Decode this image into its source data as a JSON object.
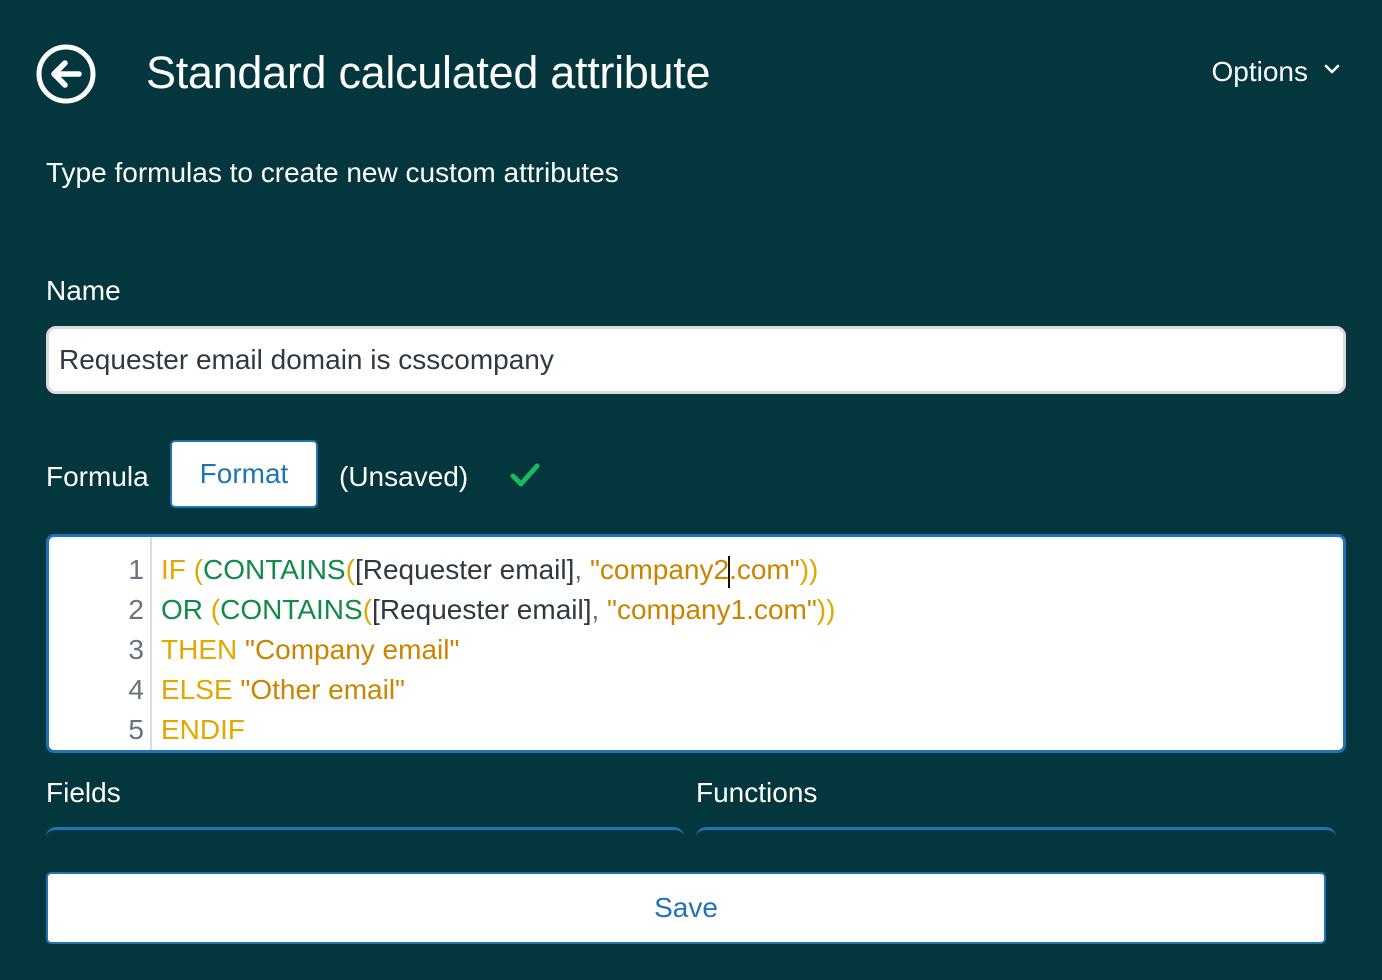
{
  "header": {
    "back_icon": "arrow-left-circle-icon",
    "title": "Standard calculated attribute",
    "options_label": "Options",
    "options_icon": "chevron-down-icon"
  },
  "subtitle": "Type formulas to create new custom attributes",
  "name_field": {
    "label": "Name",
    "value": "Requester email domain is csscompany"
  },
  "formula": {
    "label": "Formula",
    "format_button": "Format",
    "status": "(Unsaved)",
    "valid_icon": "check-icon",
    "valid_color": "#1bb85d",
    "lines": [
      {
        "number": "1",
        "tokens": [
          {
            "t": "kw",
            "v": "IF "
          },
          {
            "t": "par",
            "v": "("
          },
          {
            "t": "fn",
            "v": "CONTAINS"
          },
          {
            "t": "par",
            "v": "("
          },
          {
            "t": "txt",
            "v": "[Requester email]"
          },
          {
            "t": "punc",
            "v": ", "
          },
          {
            "t": "str",
            "v": "\"company2"
          },
          {
            "t": "caret",
            "v": ""
          },
          {
            "t": "str",
            "v": ".com\""
          },
          {
            "t": "par",
            "v": "))"
          }
        ]
      },
      {
        "number": "2",
        "tokens": [
          {
            "t": "fn",
            "v": "OR "
          },
          {
            "t": "par",
            "v": "("
          },
          {
            "t": "fn",
            "v": "CONTAINS"
          },
          {
            "t": "par",
            "v": "("
          },
          {
            "t": "txt",
            "v": "[Requester email]"
          },
          {
            "t": "punc",
            "v": ", "
          },
          {
            "t": "str",
            "v": "\"company1.com\""
          },
          {
            "t": "par",
            "v": "))"
          }
        ]
      },
      {
        "number": "3",
        "tokens": [
          {
            "t": "kw",
            "v": "THEN "
          },
          {
            "t": "str",
            "v": "\"Company email\""
          }
        ]
      },
      {
        "number": "4",
        "tokens": [
          {
            "t": "kw",
            "v": "ELSE "
          },
          {
            "t": "str",
            "v": "\"Other email\""
          }
        ]
      },
      {
        "number": "5",
        "tokens": [
          {
            "t": "kw",
            "v": "ENDIF"
          }
        ]
      }
    ]
  },
  "fields_label": "Fields",
  "functions_label": "Functions",
  "save_button": "Save",
  "colors": {
    "background": "#03363d",
    "accent": "#1f73b7",
    "keyword": "#e0a800",
    "function": "#118a4a",
    "string": "#cc8400"
  }
}
